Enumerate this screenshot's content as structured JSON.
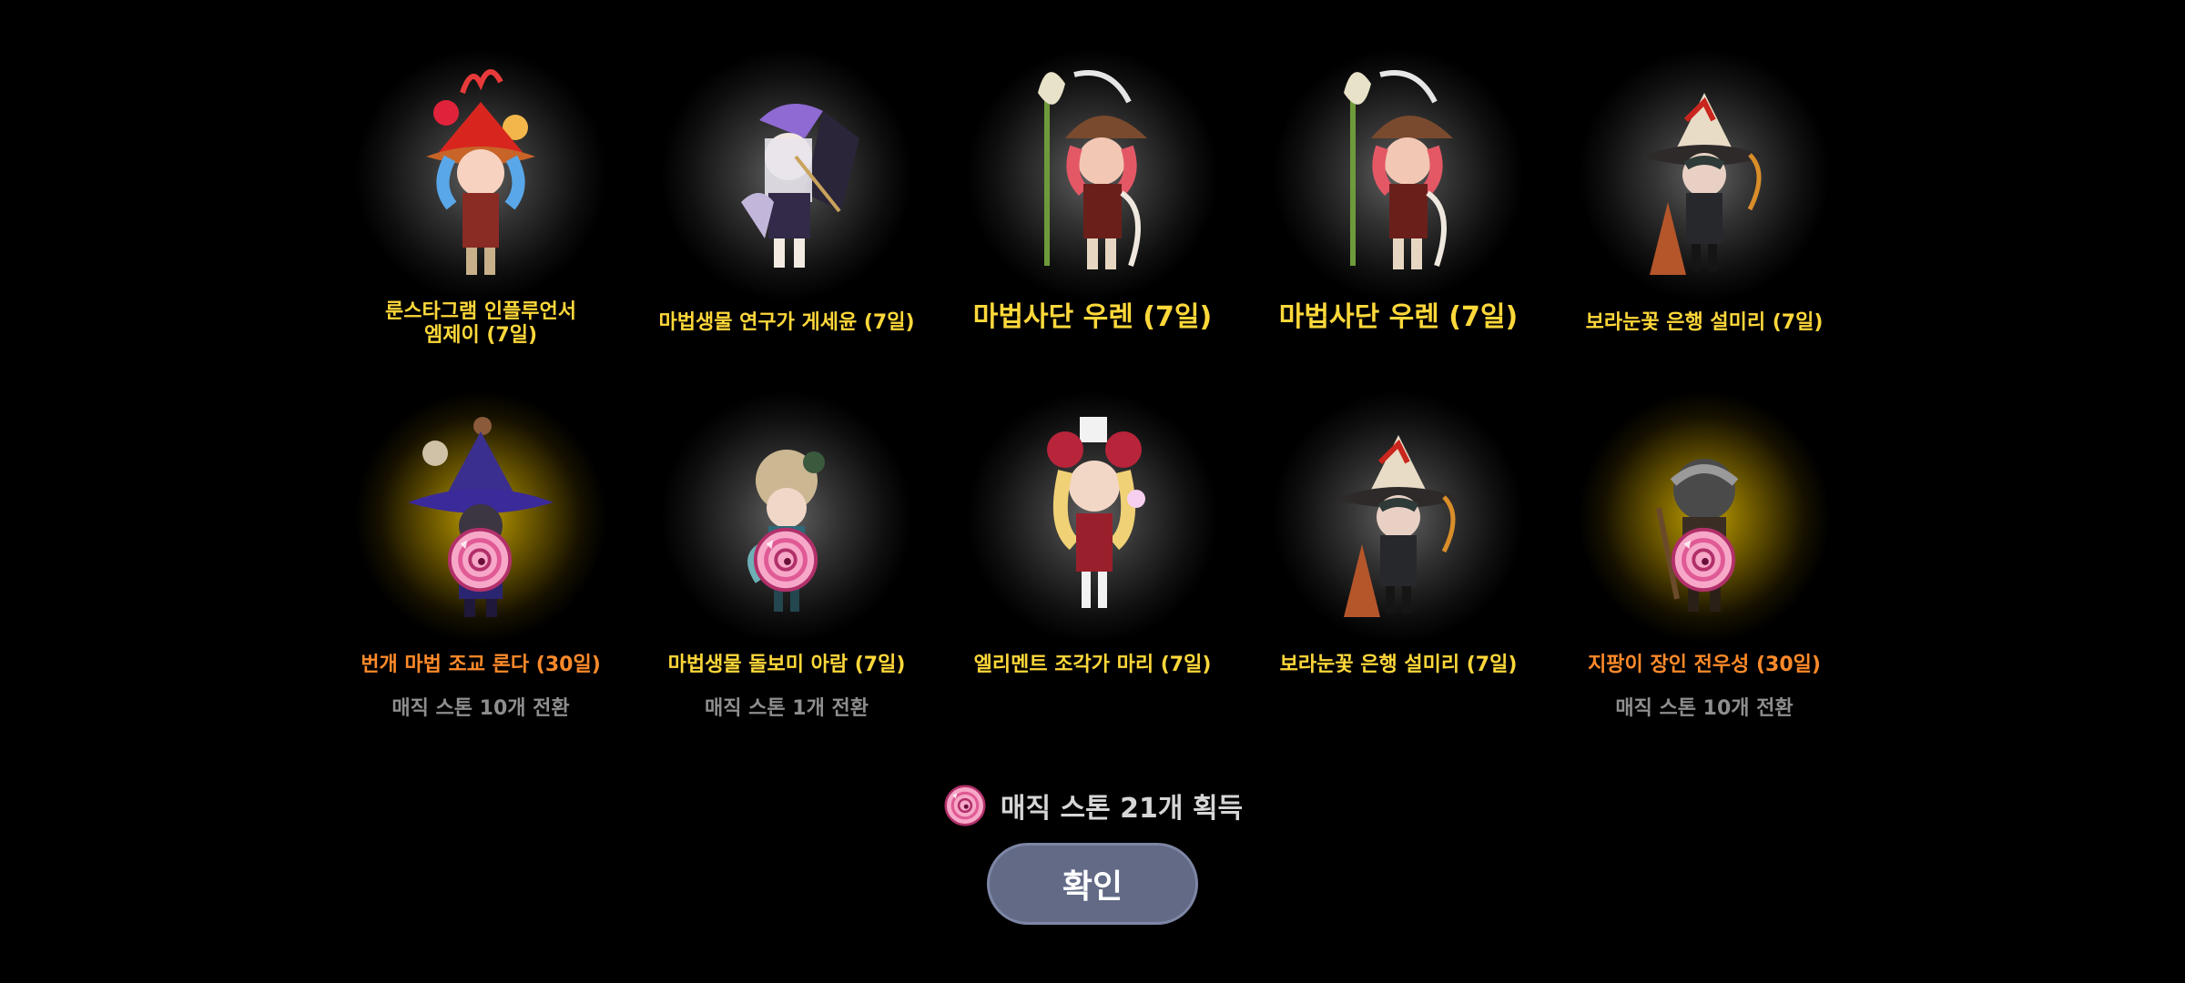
{
  "rewards": [
    {
      "name": "룬스타그램 인플루언서\n엠제이 (7일)",
      "color": "#ffd83a",
      "convert": ""
    },
    {
      "name": "마법생물 연구가 게세윤 (7일)",
      "color": "#ffd83a",
      "convert": ""
    },
    {
      "name": "마법사단 우렌 (7일)",
      "color": "#ffd83a",
      "convert": ""
    },
    {
      "name": "마법사단 우렌 (7일)",
      "color": "#ffd83a",
      "convert": ""
    },
    {
      "name": "보라눈꽃 은행 설미리 (7일)",
      "color": "#ffd83a",
      "convert": ""
    },
    {
      "name": "번개 마법 조교 론다 (30일)",
      "color": "#ff8a2a",
      "convert": "매직 스톤 10개 전환"
    },
    {
      "name": "마법생물 돌보미 아람 (7일)",
      "color": "#ffd83a",
      "convert": "매직 스톤 1개 전환"
    },
    {
      "name": "엘리멘트 조각가 마리 (7일)",
      "color": "#ffd83a",
      "convert": ""
    },
    {
      "name": "보라눈꽃 은행 설미리 (7일)",
      "color": "#ffd83a",
      "convert": ""
    },
    {
      "name": "지팡이 장인 전우성 (30일)",
      "color": "#ff8a2a",
      "convert": "매직 스톤 10개 전환"
    }
  ],
  "summary": {
    "icon": "magic-stone-icon",
    "text": "매직 스톤 21개 획득"
  },
  "confirm_button": {
    "label": "확인"
  },
  "colors": {
    "background": "#000000",
    "name_yellow": "#ffd83a",
    "name_orange": "#ff8a2a",
    "convert_gray": "#8e8e8e",
    "button_fill": "#626a86"
  }
}
